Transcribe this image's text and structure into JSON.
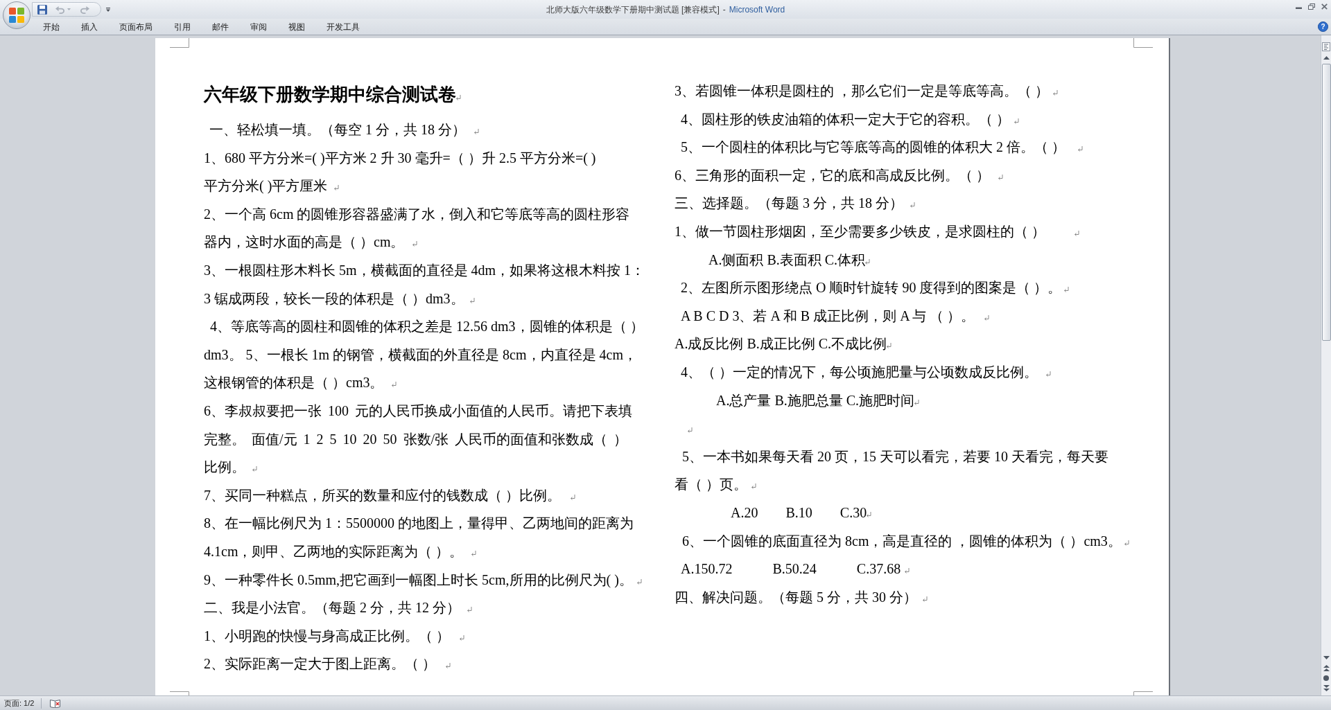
{
  "window": {
    "title": "北师大版六年级数学下册期中测试题 [兼容模式]",
    "separator": "-",
    "app_name": "Microsoft Word"
  },
  "quick_access": [
    {
      "kind": "save",
      "disabled": false
    },
    {
      "kind": "undo",
      "disabled": true
    },
    {
      "kind": "redo",
      "disabled": true
    },
    {
      "kind": "customize",
      "disabled": false
    }
  ],
  "ribbon_tabs": [
    {
      "label": "开始",
      "selected": false
    },
    {
      "label": "插入",
      "selected": false
    },
    {
      "label": "页面布局",
      "selected": false
    },
    {
      "label": "引用",
      "selected": false
    },
    {
      "label": "邮件",
      "selected": false
    },
    {
      "label": "审阅",
      "selected": false
    },
    {
      "label": "视图",
      "selected": false
    },
    {
      "label": "开发工具",
      "selected": false
    }
  ],
  "help_button": "?",
  "document": {
    "formatting_marks": true,
    "columns": [
      {
        "paragraphs": [
          {
            "kind": "title",
            "text": "六年级下册数学期中综合测试卷"
          },
          {
            "kind": "text",
            "text": "一、轻松填一填。（每空 1 分，共 18 分）"
          },
          {
            "kind": "text",
            "text": "1、680 平方分米=( )平方米 2 升 30 毫升=（ ）升 2.5 平方分米=( )平方分米( )平方厘米"
          },
          {
            "kind": "text",
            "text": "2、一个高 6cm 的圆锥形容器盛满了水，倒入和它等底等高的圆柱形容器内，这时水面的高是（ ）cm。"
          },
          {
            "kind": "text",
            "text": "3、一根圆柱形木料长 5m，横截面的直径是 4dm，如果将这根木料按 1：3 锯成两段，较长一段的体积是（ ）dm3。"
          },
          {
            "kind": "text",
            "text": "4、等底等高的圆柱和圆锥的体积之差是 12.56 dm3，圆锥的体积是（ ）dm3。 5、一根长 1m 的钢管，横截面的外直径是 8cm，内直径是 4cm，这根钢管的体积是（ ）cm3。"
          },
          {
            "kind": "text",
            "text": "6、李叔叔要把一张 100 元的人民币换成小面值的人民币。请把下表填完整。 面值/元 1 2 5 10 20 50 张数/张 人民币的面值和张数成（ ）比例。"
          },
          {
            "kind": "text",
            "text": "7、买同一种糕点，所买的数量和应付的钱数成（ ）比例。"
          },
          {
            "kind": "text",
            "text": "8、在一幅比例尺为 1：5500000 的地图上，量得甲、乙两地间的距离为 4.1cm，则甲、乙两地的实际距离为（ ）。"
          },
          {
            "kind": "text",
            "text": "9、一种零件长 0.5mm,把它画到一幅图上时长 5cm,所用的比例尺为( )。"
          },
          {
            "kind": "text",
            "text": "二、我是小法官。（每题 2 分，共 12 分）"
          },
          {
            "kind": "text",
            "text": "1、小明跑的快慢与身高成正比例。（ ）"
          },
          {
            "kind": "text",
            "text": "2、实际距离一定大于图上距离。（ ）"
          }
        ]
      },
      {
        "paragraphs": [
          {
            "kind": "text",
            "text": "3、若圆锥一体积是圆柱的 ，那么它们一定是等底等高。（ ）"
          },
          {
            "kind": "text",
            "text": "4、圆柱形的铁皮油箱的体积一定大于它的容积。（ ）"
          },
          {
            "kind": "text",
            "text": "5、一个圆柱的体积比与它等底等高的圆锥的体积大 2 倍。（ ）"
          },
          {
            "kind": "text",
            "text": "6、三角形的面积一定，它的底和高成反比例。（ ）"
          },
          {
            "kind": "text",
            "text": "三、选择题。（每题 3 分，共 18 分）"
          },
          {
            "kind": "text",
            "text": "1、做一节圆柱形烟囱，至少需要多少铁皮，是求圆柱的（ ）"
          },
          {
            "kind": "text",
            "text": "A.侧面积 B.表面积 C.体积"
          },
          {
            "kind": "text",
            "text": "2、左图所示图形绕点 O 顺时针旋转 90 度得到的图案是（ ）。"
          },
          {
            "kind": "text",
            "text": "A B C D 3、若 A 和 B 成正比例，则 A 与 （ ）。"
          },
          {
            "kind": "text",
            "text": "A.成反比例 B.成正比例 C.不成比例"
          },
          {
            "kind": "text",
            "text": "4、（ ）一定的情况下，每公顷施肥量与公顷数成反比例。"
          },
          {
            "kind": "text",
            "text": "A.总产量 B.施肥总量 C.施肥时间"
          },
          {
            "kind": "blank"
          },
          {
            "kind": "text",
            "text": "5、一本书如果每天看 20 页，15 天可以看完，若要 10 天看完，每天要看（ ）页。"
          },
          {
            "kind": "choices",
            "options": [
              "A.20",
              "B.10",
              "C.30"
            ]
          },
          {
            "kind": "text",
            "text": "6、一个圆锥的底面直径为 8cm，高是直径的 ，圆锥的体积为（ ）cm3。"
          },
          {
            "kind": "choices",
            "options": [
              "A.150.72",
              "B.50.24",
              "C.37.68"
            ]
          },
          {
            "kind": "text",
            "text": "四、解决问题。（每题 5 分，共 30 分）"
          }
        ]
      }
    ]
  },
  "status_bar": {
    "page": "页面: 1/2"
  }
}
